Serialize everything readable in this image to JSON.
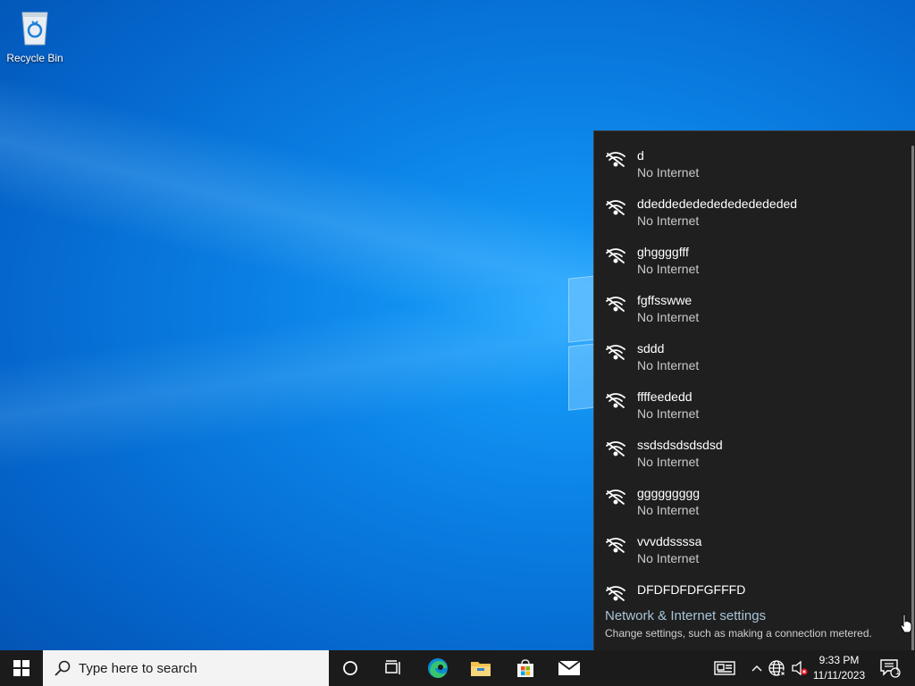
{
  "desktop": {
    "icons": [
      {
        "label": "Recycle Bin",
        "icon": "recycle-bin-icon"
      }
    ]
  },
  "network_flyout": {
    "networks": [
      {
        "name": "d",
        "status": "No Internet"
      },
      {
        "name": "ddeddededededededededed",
        "status": "No Internet"
      },
      {
        "name": "ghggggfff",
        "status": "No Internet"
      },
      {
        "name": "fgffsswwe",
        "status": "No Internet"
      },
      {
        "name": "sddd",
        "status": "No Internet"
      },
      {
        "name": "ffffeededd",
        "status": "No Internet"
      },
      {
        "name": "ssdsdsdsdsdsd",
        "status": "No Internet"
      },
      {
        "name": "ggggggggg",
        "status": "No Internet"
      },
      {
        "name": "vvvddssssa",
        "status": "No Internet"
      },
      {
        "name": "DFDFDFDFGFFFD",
        "status": ""
      }
    ],
    "settings_title": "Network & Internet settings",
    "settings_subtitle": "Change settings, such as making a connection metered."
  },
  "taskbar": {
    "search_placeholder": "Type here to search",
    "time": "9:33 PM",
    "date": "11/11/2023",
    "notification_count": "1",
    "pinned": [
      "cortana-icon",
      "task-view-icon",
      "edge-icon",
      "file-explorer-icon",
      "store-icon",
      "mail-icon"
    ]
  },
  "colors": {
    "taskbar_bg": "#1b1b1b",
    "flyout_bg": "#1f1f1f",
    "desktop_blue": "#0a7fe3"
  }
}
